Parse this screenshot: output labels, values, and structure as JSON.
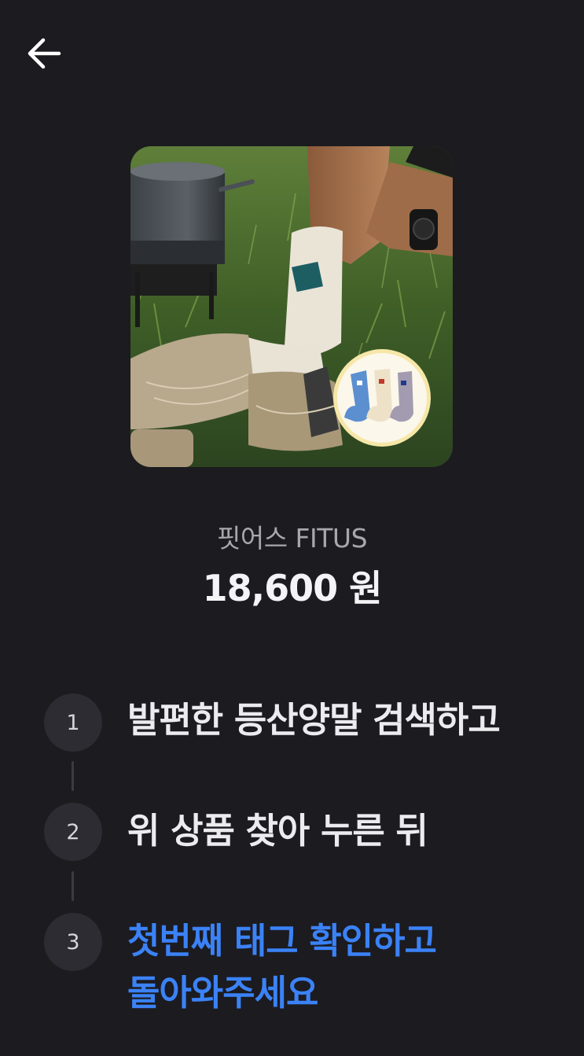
{
  "header": {
    "back_icon": "arrow-left-icon"
  },
  "product": {
    "image_alt": "hiking socks product photo",
    "brand": "핏어스 FITUS",
    "price": "18,600 원"
  },
  "steps": [
    {
      "number": "1",
      "text": "발편한 등산양말 검색하고"
    },
    {
      "number": "2",
      "text": "위 상품 찾아 누른 뒤"
    },
    {
      "number": "3",
      "text_line1": "첫번째 태그 확인하고",
      "text_line2": "돌아와주세요"
    }
  ],
  "colors": {
    "background": "#1b1b20",
    "accent": "#3b82f6",
    "step_circle": "#2c2c32"
  }
}
